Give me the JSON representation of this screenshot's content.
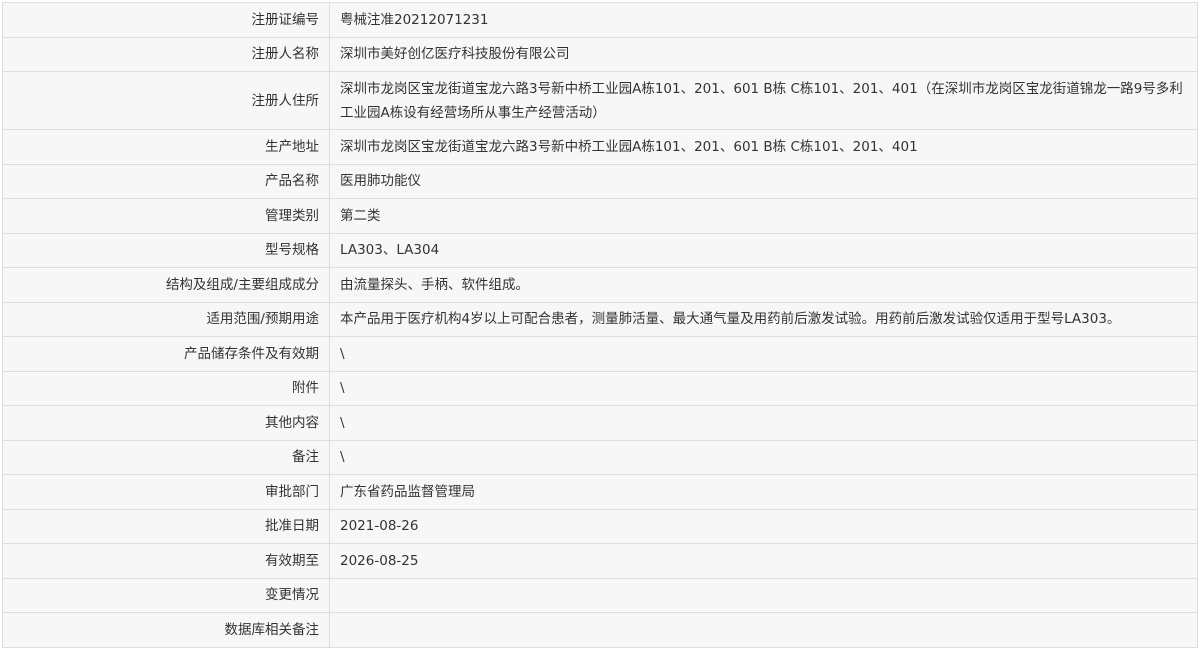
{
  "rows": [
    {
      "label": "注册证编号",
      "value": "粤械注准20212071231"
    },
    {
      "label": "注册人名称",
      "value": "深圳市美好创亿医疗科技股份有限公司"
    },
    {
      "label": "注册人住所",
      "value": "深圳市龙岗区宝龙街道宝龙六路3号新中桥工业园A栋101、201、601 B栋 C栋101、201、401（在深圳市龙岗区宝龙街道锦龙一路9号多利工业园A栋设有经营场所从事生产经营活动）"
    },
    {
      "label": "生产地址",
      "value": "深圳市龙岗区宝龙街道宝龙六路3号新中桥工业园A栋101、201、601 B栋 C栋101、201、401"
    },
    {
      "label": "产品名称",
      "value": "医用肺功能仪"
    },
    {
      "label": "管理类别",
      "value": "第二类"
    },
    {
      "label": "型号规格",
      "value": "LA303、LA304"
    },
    {
      "label": "结构及组成/主要组成成分",
      "value": "由流量探头、手柄、软件组成。"
    },
    {
      "label": "适用范围/预期用途",
      "value": "本产品用于医疗机构4岁以上可配合患者，测量肺活量、最大通气量及用药前后激发试验。用药前后激发试验仅适用于型号LA303。"
    },
    {
      "label": "产品储存条件及有效期",
      "value": "\\"
    },
    {
      "label": "附件",
      "value": "\\"
    },
    {
      "label": "其他内容",
      "value": "\\"
    },
    {
      "label": "备注",
      "value": "\\"
    },
    {
      "label": "审批部门",
      "value": "广东省药品监督管理局"
    },
    {
      "label": "批准日期",
      "value": "2021-08-26"
    },
    {
      "label": "有效期至",
      "value": "2026-08-25"
    },
    {
      "label": "变更情况",
      "value": ""
    },
    {
      "label": "数据库相关备注",
      "value": ""
    }
  ]
}
